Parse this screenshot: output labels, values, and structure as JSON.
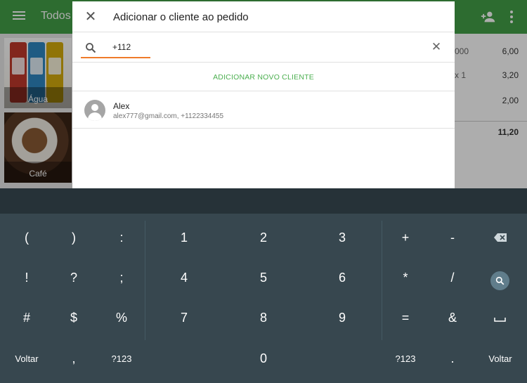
{
  "app": {
    "title": "Todos",
    "icons": {
      "menu": "menu-icon",
      "add_person": "person-add-icon",
      "more": "more-vert-icon"
    },
    "colors": {
      "app_bar": "#43a047",
      "accent": "#ef7b2b",
      "action": "#4caf50"
    },
    "products": [
      {
        "label": "Água"
      },
      {
        "label": "Café"
      }
    ],
    "order": {
      "line1_qty": "000",
      "line1_price": "6,00",
      "line2_qty": "x 1",
      "line2_price": "3,20",
      "line3_price": "2,00",
      "total": "11,20"
    }
  },
  "dialog": {
    "title": "Adicionar o cliente ao pedido",
    "search_value": "+112",
    "add_new_label": "ADICIONAR NOVO CLIENTE",
    "client": {
      "name": "Alex",
      "details": "alex777@gmail.com, +1122334455"
    }
  },
  "keyboard": {
    "row1": [
      "(",
      ")",
      ":",
      "1",
      "2",
      "3",
      "+",
      "-"
    ],
    "row2": [
      "!",
      "?",
      ";",
      "4",
      "5",
      "6",
      "*",
      "/"
    ],
    "row3": [
      "#",
      "$",
      "%",
      "7",
      "8",
      "9",
      "=",
      "&"
    ],
    "row4": {
      "left": "Voltar",
      "comma": ",",
      "sym_left": "?123",
      "zero": "0",
      "sym_right": "?123",
      "dot": ".",
      "right": "Voltar"
    },
    "icons": {
      "backspace": "backspace-icon",
      "search": "search-icon",
      "space": "space-bar-icon"
    }
  }
}
